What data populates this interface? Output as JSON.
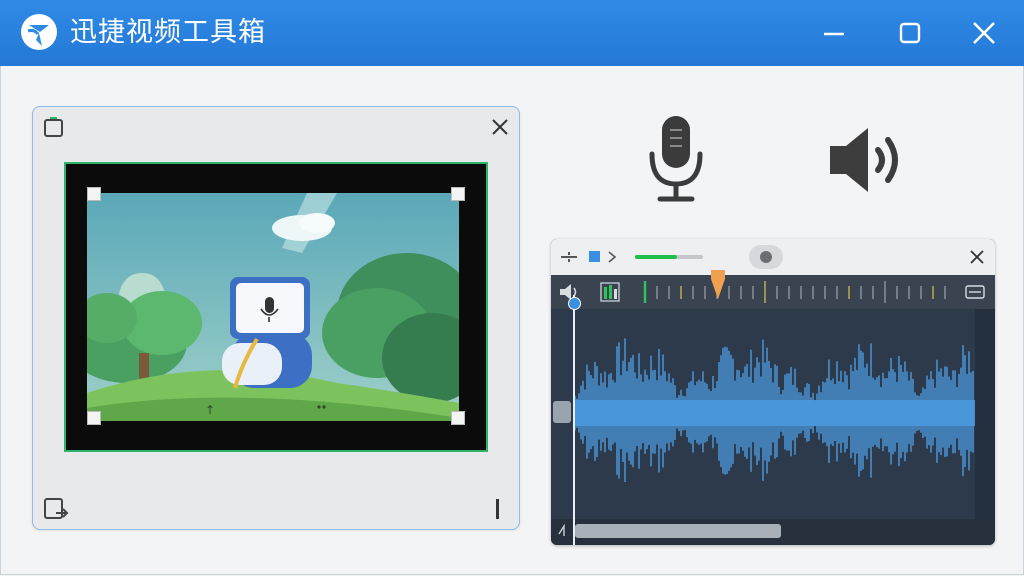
{
  "app": {
    "title": "迅捷视频工具箱",
    "logo_icon": "swirl-logo-icon"
  },
  "window_controls": {
    "minimize_icon": "minimize-icon",
    "maximize_icon": "maximize-icon",
    "close_icon": "close-icon"
  },
  "preview": {
    "expand_icon": "expand-icon",
    "close_icon": "close-icon",
    "export_icon": "export-icon",
    "scene_icon": "microphone-sign-icon"
  },
  "voice_tools": {
    "microphone_icon": "microphone-icon",
    "speaker_icon": "speaker-icon"
  },
  "audio_editor": {
    "toolbar": {
      "split_icon": "split-icon",
      "stop_icon": "stop-square-icon",
      "next_icon": "chevron-right-icon",
      "input_level": 0.62,
      "record_icon": "record-icon",
      "close_icon": "close-icon"
    },
    "ruler": {
      "volume_icon": "volume-icon",
      "meter_icon": "level-meter-icon",
      "menu_icon": "menu-icon"
    }
  },
  "colors": {
    "titlebar": "#2f8ae6",
    "accent_blue": "#3a8fe0",
    "waveform": "#4b9be0",
    "playhead": "#f0a050",
    "level_green": "#1fc04a",
    "editor_bg": "#2d3a4b"
  }
}
